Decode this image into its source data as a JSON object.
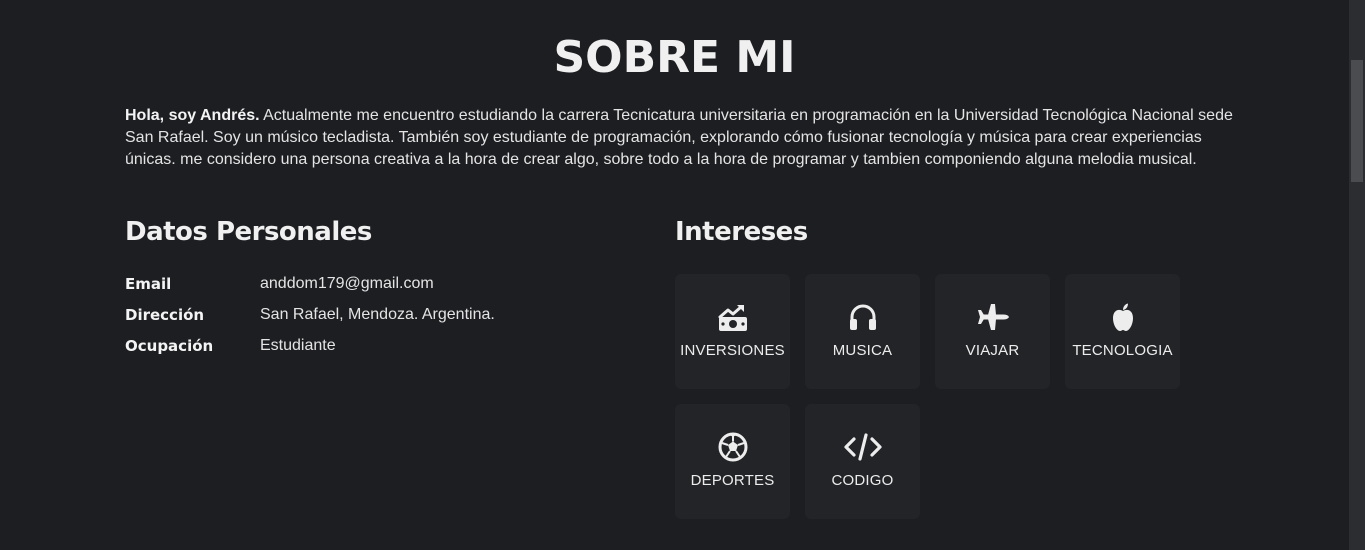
{
  "section": {
    "title": "SOBRE MI"
  },
  "intro": {
    "greeting": "Hola, soy Andrés.",
    "text": " Actualmente me encuentro estudiando la carrera Tecnicatura universitaria en programación en la Universidad Tecnológica Nacional sede San Rafael. Soy un músico tecladista. También soy estudiante de programación, explorando cómo fusionar tecnología y música para crear experiencias únicas. me considero una persona creativa a la hora de crear algo, sobre todo a la hora de programar y tambien componiendo alguna melodia musical."
  },
  "personal": {
    "heading": "Datos Personales",
    "rows": [
      {
        "label": "Email",
        "value": "anddom179@gmail.com"
      },
      {
        "label": "Dirección",
        "value": "San Rafael, Mendoza. Argentina."
      },
      {
        "label": "Ocupación",
        "value": "Estudiante"
      }
    ]
  },
  "interests": {
    "heading": "Intereses",
    "items": [
      {
        "label": "INVERSIONES",
        "icon": "money-bill-trend-icon"
      },
      {
        "label": "MUSICA",
        "icon": "headphones-icon"
      },
      {
        "label": "VIAJAR",
        "icon": "plane-icon"
      },
      {
        "label": "TECNOLOGIA",
        "icon": "apple-icon"
      },
      {
        "label": "DEPORTES",
        "icon": "soccer-ball-icon"
      },
      {
        "label": "CODIGO",
        "icon": "code-icon"
      }
    ]
  },
  "colors": {
    "background": "#1c1e21",
    "card": "#222427",
    "text": "#e8e8e8"
  }
}
